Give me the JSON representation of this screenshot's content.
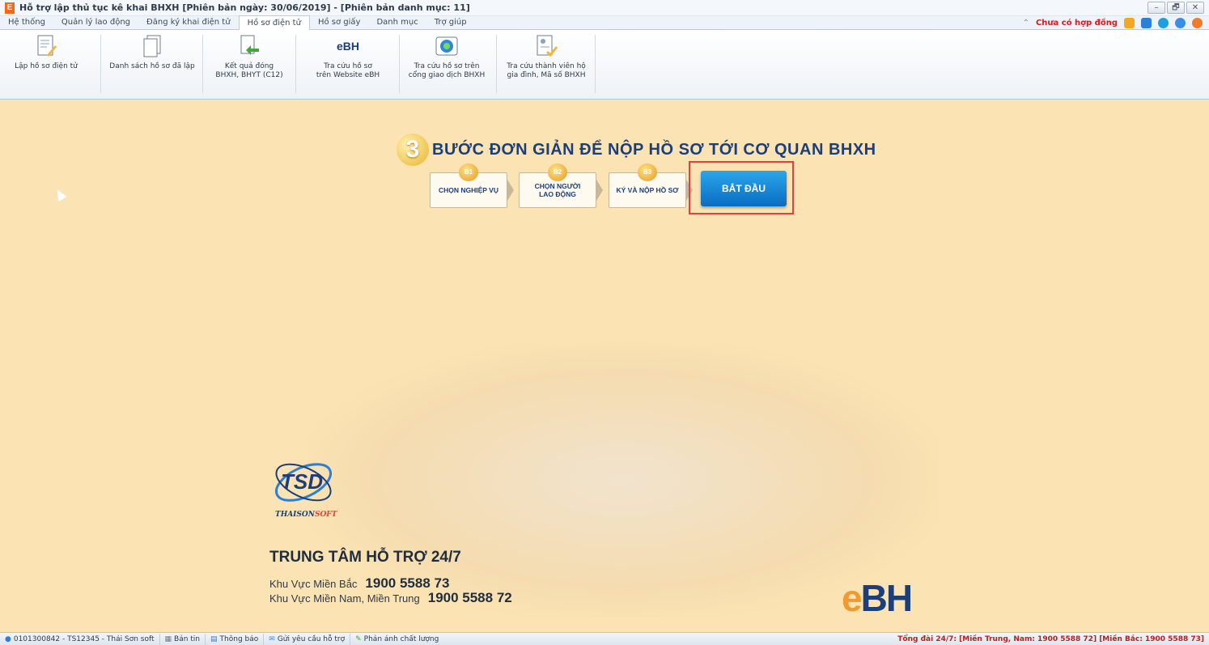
{
  "window": {
    "app_icon": "E",
    "title": "Hỗ trợ lập thủ tục kê khai BHXH [Phiên bản ngày: 30/06/2019] - [Phiên bản danh mục: 11]",
    "controls": {
      "minimize": "–",
      "restore": "🗗",
      "close": "✕"
    }
  },
  "menu": {
    "tabs": [
      "Hệ thống",
      "Quản lý lao động",
      "Đăng ký khai điện tử",
      "Hồ sơ điện tử",
      "Hồ sơ giấy",
      "Danh mục",
      "Trợ giúp"
    ],
    "active_tab": "Hồ sơ điện tử",
    "contract_status": "Chưa có hợp đồng"
  },
  "ribbon": {
    "items": [
      {
        "label": "Lập hồ sơ điện tử",
        "icon": "document-edit-icon"
      },
      {
        "label": "Danh sách hồ sơ đã lập",
        "icon": "documents-list-icon"
      },
      {
        "label": "Kết quả đóng\nBHXH, BHYT (C12)",
        "icon": "result-arrow-icon"
      },
      {
        "label": "Tra cứu hồ sơ\ntrên Website eBH",
        "icon": "ebh-logo-icon"
      },
      {
        "label": "Tra cứu hồ sơ trên\ncổng giao dịch BHXH",
        "icon": "bhxh-emblem-icon"
      },
      {
        "label": "Tra cứu thành viên hộ\ngia đình, Mã số BHXH",
        "icon": "member-card-icon"
      }
    ],
    "ebh_icon_text": "eBH"
  },
  "main": {
    "headline_number": "3",
    "headline": "BƯỚC ĐƠN GIẢN ĐỂ NỘP HỒ SƠ TỚI CƠ QUAN BHXH",
    "steps": [
      {
        "badge": "B1",
        "label": "CHỌN NGHIỆP VỤ"
      },
      {
        "badge": "B2",
        "label": "CHỌN NGƯỜI\nLAO ĐỘNG"
      },
      {
        "badge": "B3",
        "label": "KÝ VÀ NỘP HỒ SƠ"
      }
    ],
    "start_button": "BẮT ĐẦU",
    "company_logo_text": "TSD",
    "company_name_part1": "THAISON",
    "company_name_part2": "SOFT",
    "support_title": "TRUNG TÂM HỖ TRỢ 24/7",
    "support_north_label": "Khu Vực Miền Bắc",
    "support_north_phone": "1900 5588 73",
    "support_south_label": "Khu Vực Miền Nam, Miền Trung",
    "support_south_phone": "1900 5588 72",
    "ebh_logo_e": "e",
    "ebh_logo_rest": "BH",
    "colors": {
      "accent_blue": "#1c3f7a",
      "ebh_orange": "#f29a2e",
      "highlight_red": "#e2423a"
    }
  },
  "status": {
    "user": "0101300842 - TS12345 - Thái Sơn soft",
    "news": "Bản tin",
    "notice": "Thông báo",
    "support_request": "Gửi yêu cầu hỗ trợ",
    "feedback": "Phản ánh chất lượng",
    "hotline": "Tổng đài 24/7: [Miền Trung, Nam: 1900 5588 72] [Miền Bắc: 1900 5588 73]"
  }
}
